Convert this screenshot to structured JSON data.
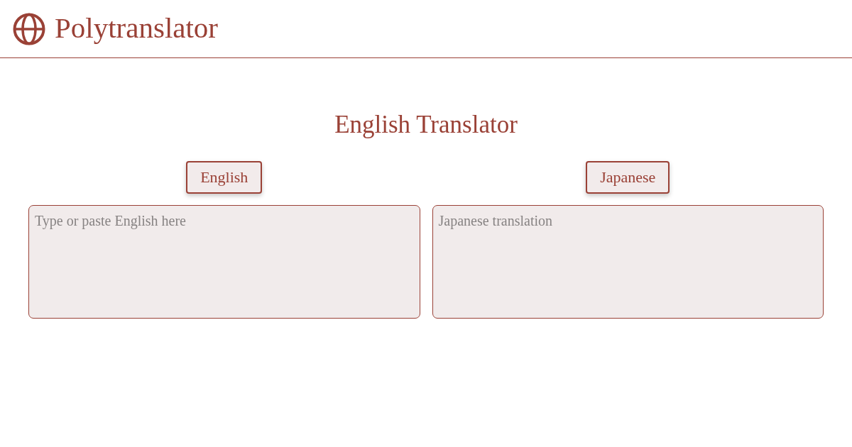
{
  "header": {
    "title": "Polytranslator"
  },
  "heading": "English Translator",
  "panels": [
    {
      "language": "English",
      "placeholder": "Type or paste English here"
    },
    {
      "language": "Japanese",
      "placeholder": "Japanese translation"
    }
  ]
}
